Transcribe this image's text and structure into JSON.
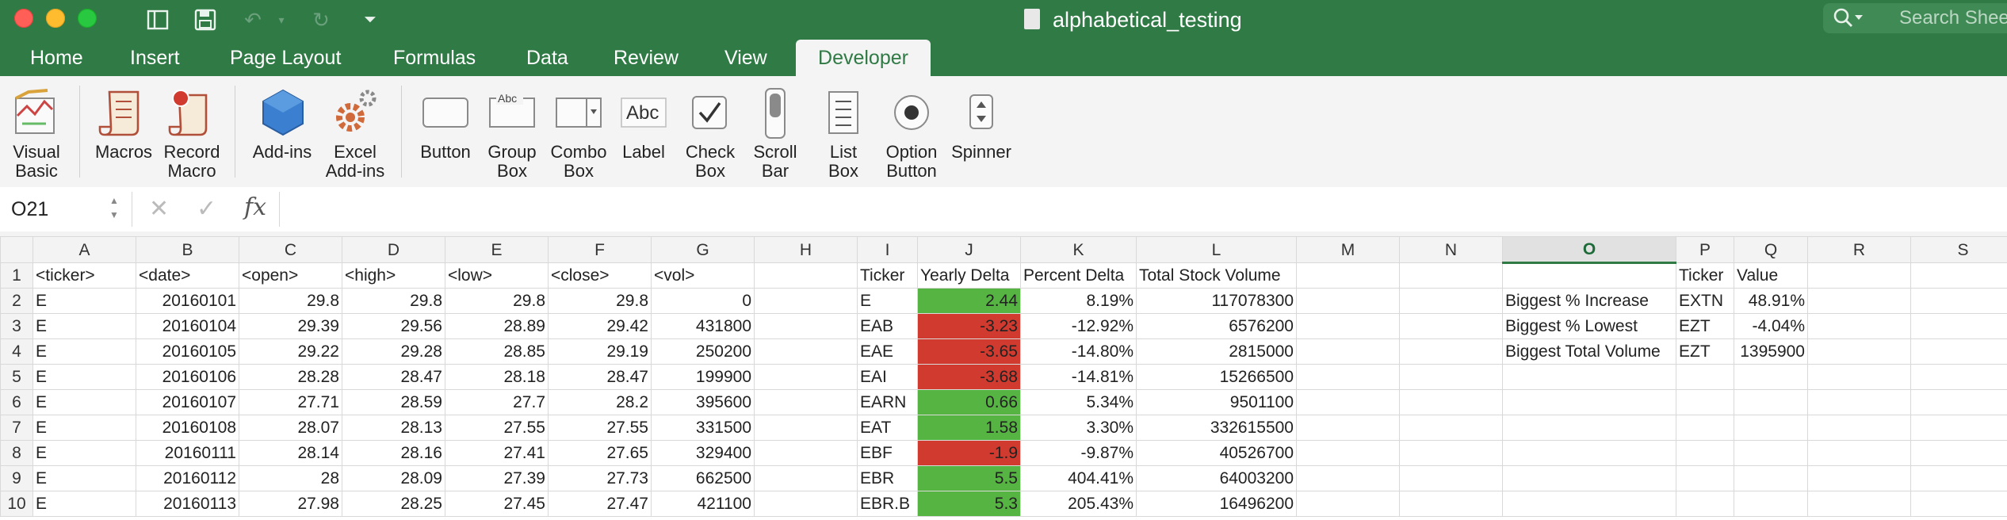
{
  "window": {
    "title": "alphabetical_testing",
    "search_placeholder": "Search Sheet"
  },
  "tabs": [
    {
      "label": "Home"
    },
    {
      "label": "Insert"
    },
    {
      "label": "Page Layout"
    },
    {
      "label": "Formulas"
    },
    {
      "label": "Data"
    },
    {
      "label": "Review"
    },
    {
      "label": "View"
    },
    {
      "label": "Developer",
      "active": true
    }
  ],
  "ribbon": {
    "visual_basic": [
      "Visual",
      "Basic"
    ],
    "macros": "Macros",
    "record_macro": [
      "Record",
      "Macro"
    ],
    "add_ins": "Add-ins",
    "excel_add_ins": [
      "Excel",
      "Add-ins"
    ],
    "button": "Button",
    "group_box": [
      "Group",
      "Box"
    ],
    "combo_box": [
      "Combo",
      "Box"
    ],
    "label": "Label",
    "check_box": [
      "Check",
      "Box"
    ],
    "scroll_bar": [
      "Scroll",
      "Bar"
    ],
    "list_box": [
      "List",
      "Box"
    ],
    "option_button": [
      "Option",
      "Button"
    ],
    "spinner": "Spinner",
    "group_box_preview": "Abc",
    "label_preview": "Abc"
  },
  "formula_bar": {
    "name_box": "O21",
    "fx": "fx",
    "formula": ""
  },
  "columns": [
    "A",
    "B",
    "C",
    "D",
    "E",
    "F",
    "G",
    "H",
    "I",
    "J",
    "K",
    "L",
    "M",
    "N",
    "O",
    "P",
    "Q",
    "R",
    "S"
  ],
  "selected_column": "O",
  "colors": {
    "title_green": "#2f7a45",
    "negative_fill": "#d13b2f",
    "positive_fill": "#56b443"
  },
  "rows": [
    {
      "n": "1",
      "A": "<ticker>",
      "B": "<date>",
      "C": "<open>",
      "D": "<high>",
      "E": "<low>",
      "F": "<close>",
      "G": "<vol>",
      "I": "Ticker",
      "J": "Yearly Delta",
      "K": "Percent Delta",
      "L": "Total Stock Volume",
      "O": "",
      "P": "Ticker",
      "Q": "Value"
    },
    {
      "n": "2",
      "A": "E",
      "B": "20160101",
      "C": "29.8",
      "D": "29.8",
      "E": "29.8",
      "F": "29.8",
      "G": "0",
      "I": "E",
      "J": "2.44",
      "K": "8.19%",
      "L": "117078300",
      "O": "Biggest % Increase",
      "P": "EXTN",
      "Q": "48.91%"
    },
    {
      "n": "3",
      "A": "E",
      "B": "20160104",
      "C": "29.39",
      "D": "29.56",
      "E": "28.89",
      "F": "29.42",
      "G": "431800",
      "I": "EAB",
      "J": "-3.23",
      "K": "-12.92%",
      "L": "6576200",
      "O": "Biggest % Lowest",
      "P": "EZT",
      "Q": "-4.04%"
    },
    {
      "n": "4",
      "A": "E",
      "B": "20160105",
      "C": "29.22",
      "D": "29.28",
      "E": "28.85",
      "F": "29.19",
      "G": "250200",
      "I": "EAE",
      "J": "-3.65",
      "K": "-14.80%",
      "L": "2815000",
      "O": "Biggest Total Volume",
      "P": "EZT",
      "Q": "1395900"
    },
    {
      "n": "5",
      "A": "E",
      "B": "20160106",
      "C": "28.28",
      "D": "28.47",
      "E": "28.18",
      "F": "28.47",
      "G": "199900",
      "I": "EAI",
      "J": "-3.68",
      "K": "-14.81%",
      "L": "15266500",
      "O": "",
      "P": "",
      "Q": ""
    },
    {
      "n": "6",
      "A": "E",
      "B": "20160107",
      "C": "27.71",
      "D": "28.59",
      "E": "27.7",
      "F": "28.2",
      "G": "395600",
      "I": "EARN",
      "J": "0.66",
      "K": "5.34%",
      "L": "9501100",
      "O": "",
      "P": "",
      "Q": ""
    },
    {
      "n": "7",
      "A": "E",
      "B": "20160108",
      "C": "28.07",
      "D": "28.13",
      "E": "27.55",
      "F": "27.55",
      "G": "331500",
      "I": "EAT",
      "J": "1.58",
      "K": "3.30%",
      "L": "332615500",
      "O": "",
      "P": "",
      "Q": ""
    },
    {
      "n": "8",
      "A": "E",
      "B": "20160111",
      "C": "28.14",
      "D": "28.16",
      "E": "27.41",
      "F": "27.65",
      "G": "329400",
      "I": "EBF",
      "J": "-1.9",
      "K": "-9.87%",
      "L": "40526700",
      "O": "",
      "P": "",
      "Q": ""
    },
    {
      "n": "9",
      "A": "E",
      "B": "20160112",
      "C": "28",
      "D": "28.09",
      "E": "27.39",
      "F": "27.73",
      "G": "662500",
      "I": "EBR",
      "J": "5.5",
      "K": "404.41%",
      "L": "64003200",
      "O": "",
      "P": "",
      "Q": ""
    },
    {
      "n": "10",
      "A": "E",
      "B": "20160113",
      "C": "27.98",
      "D": "28.25",
      "E": "27.45",
      "F": "27.47",
      "G": "421100",
      "I": "EBR.B",
      "J": "5.3",
      "K": "205.43%",
      "L": "16496200",
      "O": "",
      "P": "",
      "Q": ""
    }
  ]
}
